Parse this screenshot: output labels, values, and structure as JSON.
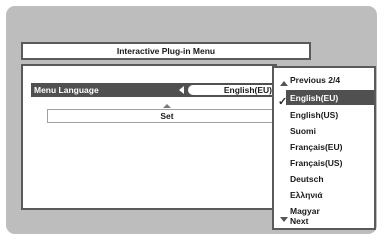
{
  "window": {
    "title": "Interactive Plug-in Menu"
  },
  "setting": {
    "label": "Menu Language",
    "value": "English(EU)"
  },
  "action": {
    "set_label": "Set"
  },
  "dropdown": {
    "previous": "Previous 2/4",
    "items": [
      "English(EU)",
      "English(US)",
      "Suomi",
      "Français(EU)",
      "Français(US)",
      "Deutsch",
      "Ελληνιά",
      "Magyar"
    ],
    "selected_index": 0,
    "next": "Next"
  },
  "colors": {
    "screen_bg": "#bdbdbd",
    "highlight": "#505050",
    "border": "#5a5a5a"
  }
}
